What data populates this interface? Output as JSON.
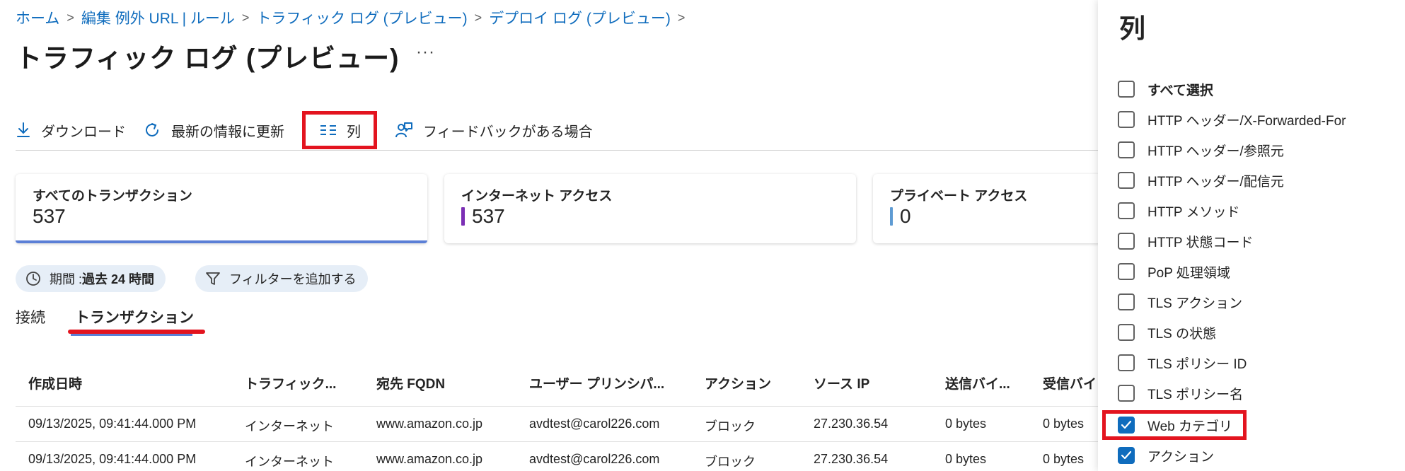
{
  "breadcrumb": {
    "items": [
      "ホーム",
      "編集 例外 URL | ルール",
      "トラフィック ログ (プレビュー)",
      "デプロイ ログ (プレビュー)"
    ]
  },
  "page": {
    "title": "トラフィック ログ (プレビュー)",
    "more": "···"
  },
  "toolbar": {
    "download": "ダウンロード",
    "refresh": "最新の情報に更新",
    "columns": "列",
    "feedback": "フィードバックがある場合"
  },
  "cards": [
    {
      "label": "すべてのトランザクション",
      "value": "537"
    },
    {
      "label": "インターネット アクセス",
      "value": "537",
      "color": "#7b2fb4"
    },
    {
      "label": "プライベート アクセス",
      "value": "0",
      "color": "#5e9bd3"
    }
  ],
  "filters": {
    "period_prefix": "期間 : ",
    "period_value": "過去 24 時間",
    "add_filter": "フィルターを追加する"
  },
  "tabs": [
    "接続",
    "トランザクション"
  ],
  "table": {
    "headers": [
      "作成日時",
      "トラフィック...",
      "宛先 FQDN",
      "ユーザー プリンシパ...",
      "アクション",
      "ソース IP",
      "送信バイ...",
      "受信バイ"
    ],
    "rows": [
      [
        "09/13/2025, 09:41:44.000 PM",
        "インターネット",
        "www.amazon.co.jp",
        "avdtest@carol226.com",
        "ブロック",
        "27.230.36.54",
        "0 bytes",
        "0 bytes"
      ],
      [
        "09/13/2025, 09:41:44.000 PM",
        "インターネット",
        "www.amazon.co.jp",
        "avdtest@carol226.com",
        "ブロック",
        "27.230.36.54",
        "0 bytes",
        "0 bytes"
      ]
    ]
  },
  "panel": {
    "title": "列",
    "options": [
      {
        "label": "すべて選択",
        "checked": false
      },
      {
        "label": "HTTP ヘッダー/X-Forwarded-For",
        "checked": false
      },
      {
        "label": "HTTP ヘッダー/参照元",
        "checked": false
      },
      {
        "label": "HTTP ヘッダー/配信元",
        "checked": false
      },
      {
        "label": "HTTP メソッド",
        "checked": false
      },
      {
        "label": "HTTP 状態コード",
        "checked": false
      },
      {
        "label": "PoP 処理領域",
        "checked": false
      },
      {
        "label": "TLS アクション",
        "checked": false
      },
      {
        "label": "TLS の状態",
        "checked": false
      },
      {
        "label": "TLS ポリシー ID",
        "checked": false
      },
      {
        "label": "TLS ポリシー名",
        "checked": false
      },
      {
        "label": "Web カテゴリ",
        "checked": true
      },
      {
        "label": "アクション",
        "checked": true
      }
    ]
  },
  "colors": {
    "accent": "#0f6cbd",
    "highlight": "#e3141f"
  }
}
